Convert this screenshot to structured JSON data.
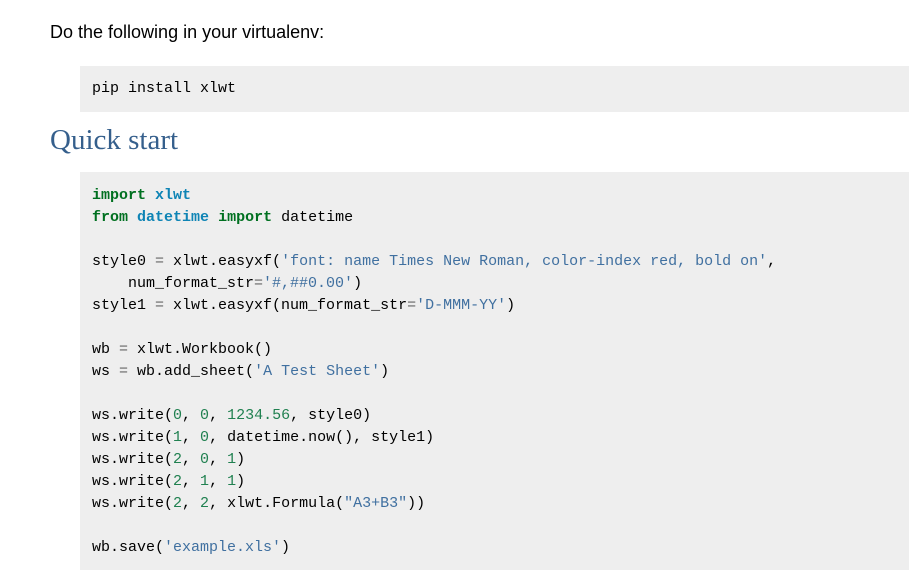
{
  "intro": {
    "text": "Do the following in your virtualenv:"
  },
  "install": {
    "command": "pip install xlwt"
  },
  "section": {
    "heading": "Quick start"
  },
  "code": {
    "line1": {
      "kw": "import",
      "mod": "xlwt"
    },
    "line2": {
      "kw_from": "from",
      "mod": "datetime",
      "kw_import": "import",
      "name": "datetime"
    },
    "line4": {
      "prefix": "style0 ",
      "eq": "=",
      "call": " xlwt.easyxf(",
      "str": "'font: name Times New Roman, color-index red, bold on'",
      "suffix": ","
    },
    "line5": {
      "prefix": "    num_format_str",
      "eq": "=",
      "str": "'#,##0.00'",
      "suffix": ")"
    },
    "line6": {
      "prefix": "style1 ",
      "eq": "=",
      "call": " xlwt.easyxf(num_format_str",
      "eq2": "=",
      "str": "'D-MMM-YY'",
      "suffix": ")"
    },
    "line8": {
      "prefix": "wb ",
      "eq": "=",
      "suffix": " xlwt.Workbook()"
    },
    "line9": {
      "prefix": "ws ",
      "eq": "=",
      "call": " wb.add_sheet(",
      "str": "'A Test Sheet'",
      "suffix": ")"
    },
    "line11": {
      "prefix": "ws.write(",
      "n1": "0",
      "c1": ", ",
      "n2": "0",
      "c2": ", ",
      "n3": "1234.56",
      "suffix": ", style0)"
    },
    "line12": {
      "prefix": "ws.write(",
      "n1": "1",
      "c1": ", ",
      "n2": "0",
      "suffix": ", datetime.now(), style1)"
    },
    "line13": {
      "prefix": "ws.write(",
      "n1": "2",
      "c1": ", ",
      "n2": "0",
      "c2": ", ",
      "n3": "1",
      "suffix": ")"
    },
    "line14": {
      "prefix": "ws.write(",
      "n1": "2",
      "c1": ", ",
      "n2": "1",
      "c2": ", ",
      "n3": "1",
      "suffix": ")"
    },
    "line15": {
      "prefix": "ws.write(",
      "n1": "2",
      "c1": ", ",
      "n2": "2",
      "call": ", xlwt.Formula(",
      "str": "\"A3+B3\"",
      "suffix": "))"
    },
    "line17": {
      "prefix": "wb.save(",
      "str": "'example.xls'",
      "suffix": ")"
    }
  }
}
